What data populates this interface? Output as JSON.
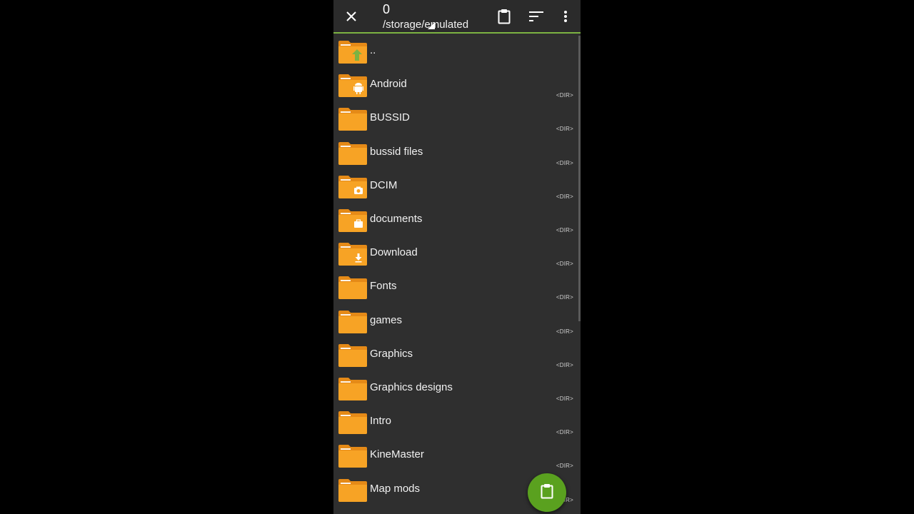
{
  "topbar": {
    "selected_count": "0",
    "path": "/storage/emulated",
    "icons": [
      "close-icon",
      "clipboard-icon",
      "sort-icon",
      "more-vert-icon"
    ]
  },
  "files": [
    {
      "name": "..",
      "badge": "up-arrow",
      "type": ""
    },
    {
      "name": "Android",
      "badge": "android",
      "type": "<DIR>"
    },
    {
      "name": "BUSSID",
      "badge": "",
      "type": "<DIR>"
    },
    {
      "name": "bussid files",
      "badge": "",
      "type": "<DIR>"
    },
    {
      "name": "DCIM",
      "badge": "camera",
      "type": "<DIR>"
    },
    {
      "name": "documents",
      "badge": "briefcase",
      "type": "<DIR>"
    },
    {
      "name": "Download",
      "badge": "download",
      "type": "<DIR>"
    },
    {
      "name": "Fonts",
      "badge": "",
      "type": "<DIR>"
    },
    {
      "name": "games",
      "badge": "",
      "type": "<DIR>"
    },
    {
      "name": "Graphics",
      "badge": "",
      "type": "<DIR>"
    },
    {
      "name": "Graphics designs",
      "badge": "",
      "type": "<DIR>"
    },
    {
      "name": "Intro",
      "badge": "",
      "type": "<DIR>"
    },
    {
      "name": "KineMaster",
      "badge": "",
      "type": "<DIR>"
    },
    {
      "name": "Map mods",
      "badge": "",
      "type": "<DIR>"
    }
  ],
  "fab": {
    "icon": "paste-icon"
  },
  "colors": {
    "accent": "#7cb342",
    "folder": "#f7a325",
    "fab": "#5aa11f"
  }
}
